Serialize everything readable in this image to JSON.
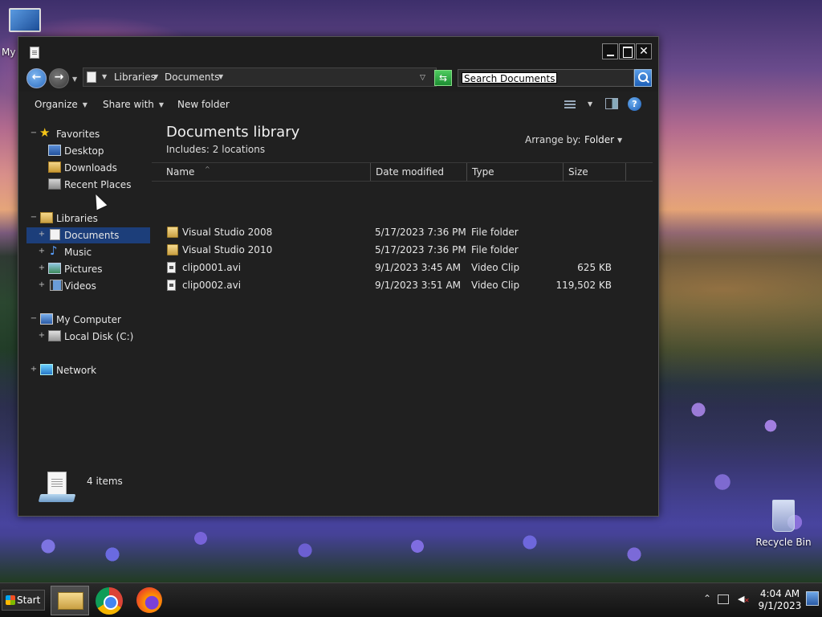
{
  "desktop": {
    "icons": [
      {
        "label": "My",
        "name": "my-computer"
      },
      {
        "label": "Recycle Bin",
        "name": "recycle-bin"
      }
    ]
  },
  "address": {
    "crumbs": [
      "Libraries",
      "Documents"
    ],
    "search_placeholder": "Search Documents"
  },
  "toolbar": {
    "organize": "Organize",
    "share_with": "Share with",
    "new_folder": "New folder"
  },
  "nav": {
    "favorites": "Favorites",
    "desktop": "Desktop",
    "downloads": "Downloads",
    "recent_places": "Recent Places",
    "libraries": "Libraries",
    "documents": "Documents",
    "music": "Music",
    "pictures": "Pictures",
    "videos": "Videos",
    "my_computer": "My Computer",
    "local_disk": "Local Disk (C:)",
    "network": "Network"
  },
  "library": {
    "title": "Documents library",
    "includes": "Includes:  2 locations",
    "arrange_label": "Arrange by:",
    "arrange_value": "Folder"
  },
  "columns": {
    "name": "Name",
    "date_modified": "Date modified",
    "type": "Type",
    "size": "Size"
  },
  "files": [
    {
      "name": "Visual Studio 2008",
      "date": "5/17/2023 7:36 PM",
      "type": "File folder",
      "size": "",
      "icon": "folder-icon"
    },
    {
      "name": "Visual Studio 2010",
      "date": "5/17/2023 7:36 PM",
      "type": "File folder",
      "size": "",
      "icon": "folder-icon"
    },
    {
      "name": "clip0001.avi",
      "date": "9/1/2023 3:45 AM",
      "type": "Video Clip",
      "size": "625 KB",
      "icon": "video-file-icon"
    },
    {
      "name": "clip0002.avi",
      "date": "9/1/2023 3:51 AM",
      "type": "Video Clip",
      "size": "119,502 KB",
      "icon": "video-file-icon"
    }
  ],
  "details": {
    "item_count": "4 items"
  },
  "taskbar": {
    "start": "Start",
    "time": "4:04 AM",
    "date": "9/1/2023"
  }
}
